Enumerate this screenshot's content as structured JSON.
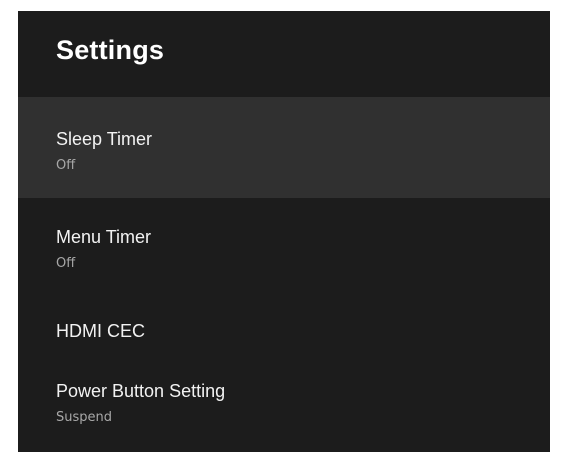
{
  "header": {
    "title": "Settings"
  },
  "menu": {
    "items": [
      {
        "label": "Sleep Timer",
        "value": "Off",
        "selected": true
      },
      {
        "label": "Menu Timer",
        "value": "Off",
        "selected": false
      },
      {
        "label": "HDMI CEC",
        "selected": false
      },
      {
        "label": "Power Button Setting",
        "value": "Suspend",
        "selected": false
      }
    ]
  },
  "colors": {
    "background": "#1c1c1c",
    "selected_background": "#303030",
    "label": "#f2f2f2",
    "value": "#a8a8a8"
  }
}
